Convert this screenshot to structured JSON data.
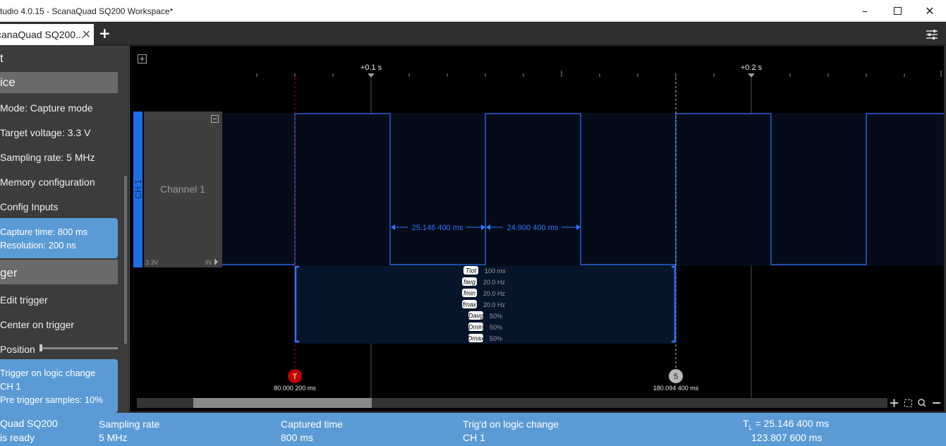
{
  "window": {
    "title": "tudio 4.0.15 - ScanaQuad SQ200 Workspace*",
    "minimize_icon": "minimize-icon",
    "maximize_icon": "maximize-icon",
    "close_icon": "close-icon"
  },
  "tabs": [
    {
      "label": "canaQuad SQ200...",
      "close": "✕"
    }
  ],
  "add_tab": "+",
  "sidebar": {
    "section_top": "t",
    "device_header": "ice",
    "device_items": [
      "Mode: Capture mode",
      "Target voltage: 3.3 V",
      "Sampling rate: 5 MHz",
      "Memory configuration",
      "Config Inputs"
    ],
    "device_info": [
      "Capture time: 800 ms",
      "Resolution: 200 ns"
    ],
    "trigger_header": "ger",
    "trigger_items": [
      "Edit trigger",
      "Center on trigger",
      "Position"
    ],
    "trigger_info": [
      "Trigger on logic change",
      "CH 1",
      "Pre trigger samples: 10%"
    ]
  },
  "timeline": {
    "ticks": [
      "+0.1 s",
      "+0.2 s"
    ]
  },
  "channel": {
    "tag": "CH 1",
    "name": "Channel 1",
    "voltage": "3.3V",
    "input": "IN"
  },
  "measurements": {
    "width1": "25.146 400 ms",
    "width2": "24.900 400 ms",
    "stats": [
      {
        "label": "Ttot",
        "value": "100 ms"
      },
      {
        "label": "favg",
        "value": "20.0 Hz"
      },
      {
        "label": "fmin",
        "value": "20.0 Hz"
      },
      {
        "label": "fmax",
        "value": "20.0 Hz"
      },
      {
        "label": "Davg",
        "value": "50%"
      },
      {
        "label": "Dmin",
        "value": "50%"
      },
      {
        "label": "Dmax",
        "value": "50%"
      }
    ]
  },
  "markers": {
    "trigger_label": "T",
    "trigger_time": "80.000 200 ms",
    "cursor_label": "5",
    "cursor_time": "180.094 400 ms"
  },
  "status": {
    "device_name": "Quad SQ200",
    "device_state": "is ready",
    "sampling_label": "Sampling rate",
    "sampling_value": "5 MHz",
    "captured_label": "Captured time",
    "captured_value": "800 ms",
    "trig_label": "Trig'd on logic change",
    "trig_value": "CH 1",
    "tl_prefix": "T",
    "tl_sub": "L",
    "tl_value": " = 25.146 400 ms",
    "tl_value2": "123.807 600 ms"
  },
  "colors": {
    "accent": "#5b9bd5",
    "wave": "#2f73ff",
    "trigger": "#c00000",
    "cursor": "#b8b8b8"
  }
}
